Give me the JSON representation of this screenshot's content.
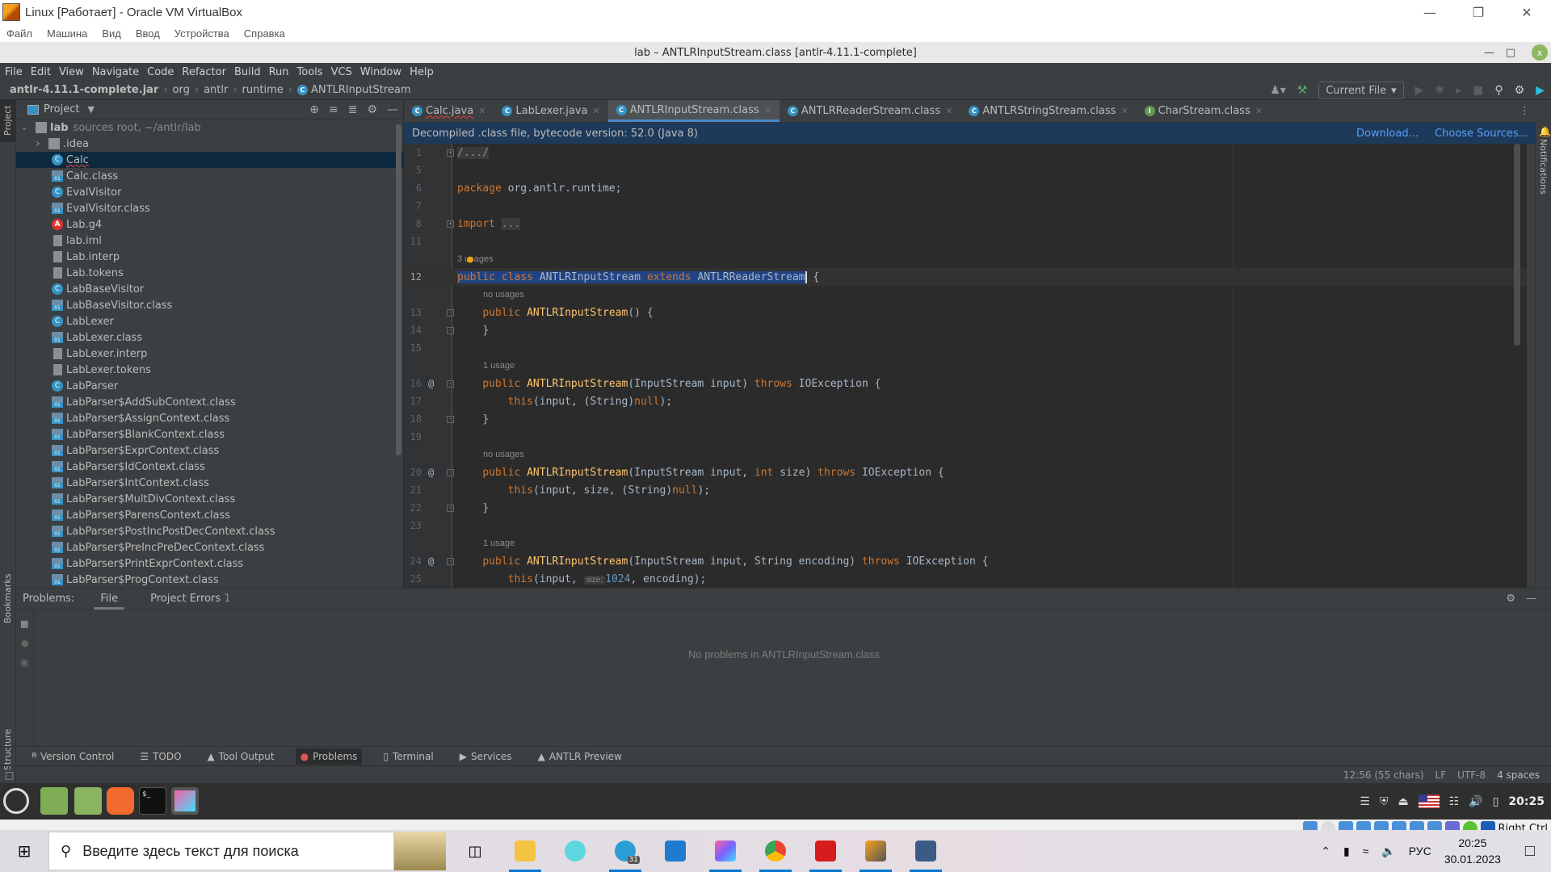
{
  "host": {
    "title": "Linux [Работает] - Oracle VM VirtualBox",
    "menu": [
      "Файл",
      "Машина",
      "Вид",
      "Ввод",
      "Устройства",
      "Справка"
    ],
    "status_right": "Right Ctrl"
  },
  "window": {
    "title": "lab – ANTLRInputStream.class [antlr-4.11.1-complete]"
  },
  "ide": {
    "menu": [
      "File",
      "Edit",
      "View",
      "Navigate",
      "Code",
      "Refactor",
      "Build",
      "Run",
      "Tools",
      "VCS",
      "Window",
      "Help"
    ],
    "breadcrumb": [
      "antlr-4.11.1-complete.jar",
      "org",
      "antlr",
      "runtime",
      "ANTLRInputStream"
    ],
    "run_config": "Current File",
    "project": {
      "title": "Project",
      "root_name": "lab",
      "root_hint": "sources root, ~/antlr/lab",
      "items": [
        {
          "name": ".idea",
          "type": "dir"
        },
        {
          "name": "Calc",
          "type": "java",
          "selected": true
        },
        {
          "name": "Calc.class",
          "type": "class"
        },
        {
          "name": "EvalVisitor",
          "type": "java"
        },
        {
          "name": "EvalVisitor.class",
          "type": "class"
        },
        {
          "name": "Lab.g4",
          "type": "g4"
        },
        {
          "name": "lab.iml",
          "type": "txt"
        },
        {
          "name": "Lab.interp",
          "type": "txt"
        },
        {
          "name": "Lab.tokens",
          "type": "txt"
        },
        {
          "name": "LabBaseVisitor",
          "type": "java"
        },
        {
          "name": "LabBaseVisitor.class",
          "type": "class"
        },
        {
          "name": "LabLexer",
          "type": "java"
        },
        {
          "name": "LabLexer.class",
          "type": "class"
        },
        {
          "name": "LabLexer.interp",
          "type": "txt"
        },
        {
          "name": "LabLexer.tokens",
          "type": "txt"
        },
        {
          "name": "LabParser",
          "type": "java"
        },
        {
          "name": "LabParser$AddSubContext.class",
          "type": "class"
        },
        {
          "name": "LabParser$AssignContext.class",
          "type": "class"
        },
        {
          "name": "LabParser$BlankContext.class",
          "type": "class"
        },
        {
          "name": "LabParser$ExprContext.class",
          "type": "class"
        },
        {
          "name": "LabParser$IdContext.class",
          "type": "class"
        },
        {
          "name": "LabParser$IntContext.class",
          "type": "class"
        },
        {
          "name": "LabParser$MultDivContext.class",
          "type": "class"
        },
        {
          "name": "LabParser$ParensContext.class",
          "type": "class"
        },
        {
          "name": "LabParser$PostIncPostDecContext.class",
          "type": "class"
        },
        {
          "name": "LabParser$PreIncPreDecContext.class",
          "type": "class"
        },
        {
          "name": "LabParser$PrintExprContext.class",
          "type": "class"
        },
        {
          "name": "LabParser$ProgContext.class",
          "type": "class"
        }
      ]
    },
    "tabs": [
      {
        "label": "Calc.java",
        "icon": "C"
      },
      {
        "label": "LabLexer.java",
        "icon": "C"
      },
      {
        "label": "ANTLRInputStream.class",
        "icon": "C",
        "active": true
      },
      {
        "label": "ANTLRReaderStream.class",
        "icon": "C"
      },
      {
        "label": "ANTLRStringStream.class",
        "icon": "C"
      },
      {
        "label": "CharStream.class",
        "icon": "I"
      }
    ],
    "banner": {
      "text": "Decompiled .class file, bytecode version: 52.0 (Java 8)",
      "download": "Download...",
      "choose_sources": "Choose Sources..."
    },
    "code": {
      "l1": "1",
      "l1_text": "/.../",
      "l5": "5",
      "l6": "6",
      "l6_kw": "package",
      "l6_text": " org.antlr.runtime;",
      "l7": "7",
      "l8": "8",
      "l8_kw": "import",
      "l8_fold": "...",
      "l11": "11",
      "h12": "3 usages",
      "l12": "12",
      "l12_kw1": "public",
      "l12_kw2": "class",
      "l12_name": "ANTLRInputStream",
      "l12_kw3": "extends",
      "l12_super": "ANTLRReaderStream",
      "l12_tail": " {",
      "h13": "no usages",
      "l13": "13",
      "l13_kw": "public",
      "l13_fn": "ANTLRInputStream",
      "l13_tail": "() {",
      "l14": "14",
      "l14_text": "}",
      "l15": "15",
      "h16": "1 usage",
      "l16": "16",
      "l16_kw": "public",
      "l16_fn": "ANTLRInputStream",
      "l16_args": "(InputStream input) ",
      "l16_kw2": "throws",
      "l16_tail": " IOException {",
      "l17": "17",
      "l17_kw": "this",
      "l17_a": "(input, (String)",
      "l17_null": "null",
      "l17_tail": ");",
      "l18": "18",
      "l18_text": "}",
      "l19": "19",
      "h20": "no usages",
      "l20": "20",
      "l20_kw": "public",
      "l20_fn": "ANTLRInputStream",
      "l20_a": "(InputStream input, ",
      "l20_int": "int",
      "l20_b": " size) ",
      "l20_kw2": "throws",
      "l20_tail": " IOException {",
      "l21": "21",
      "l21_kw": "this",
      "l21_a": "(input, size, (String)",
      "l21_null": "null",
      "l21_tail": ");",
      "l22": "22",
      "l22_text": "}",
      "l23": "23",
      "h24": "1 usage",
      "l24": "24",
      "l24_kw": "public",
      "l24_fn": "ANTLRInputStream",
      "l24_a": "(InputStream input, String encoding) ",
      "l24_kw2": "throws",
      "l24_tail": " IOException {",
      "l25": "25",
      "l25_kw": "this",
      "l25_a": "(input, ",
      "l25_hint": "size:",
      "l25_num": "1024",
      "l25_tail": ", encoding);"
    },
    "problems": {
      "label": "Problems:",
      "tabs": [
        {
          "label": "File",
          "active": true
        },
        {
          "label": "Project Errors",
          "count": "1"
        }
      ],
      "empty": "No problems in ANTLRInputStream.class"
    },
    "tool_windows": [
      "Version Control",
      "TODO",
      "Tool Output",
      "Problems",
      "Terminal",
      "Services",
      "ANTLR Preview"
    ],
    "active_tool_window": "Problems",
    "side_labels": {
      "project": "Project",
      "bookmarks": "Bookmarks",
      "structure": "Structure",
      "notifications": "Notifications"
    },
    "status": {
      "position": "12:56 (55 chars)",
      "line_sep": "LF",
      "encoding": "UTF-8",
      "indent": "4 spaces"
    }
  },
  "mint_panel": {
    "clock": "20:25"
  },
  "windows": {
    "search_placeholder": "Введите здесь текст для поиска",
    "lang": "РУС",
    "time": "20:25",
    "date": "30.01.2023",
    "telegram_badge": "31"
  }
}
